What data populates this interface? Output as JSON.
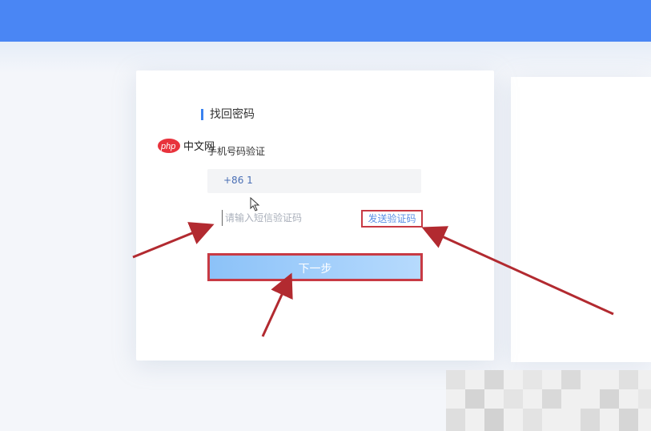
{
  "page": {
    "title": "找回密码",
    "subtitle": "手机号码验证"
  },
  "phone": {
    "prefix": "+86  1"
  },
  "code": {
    "placeholder": "请输入短信验证码",
    "send_label": "发送验证码"
  },
  "next_button": {
    "label": "下一步"
  },
  "watermark": {
    "text": "php 中文网"
  },
  "colors": {
    "topbar": "#4a86f4",
    "accent": "#3a82f0",
    "highlight": "#c83a44"
  }
}
